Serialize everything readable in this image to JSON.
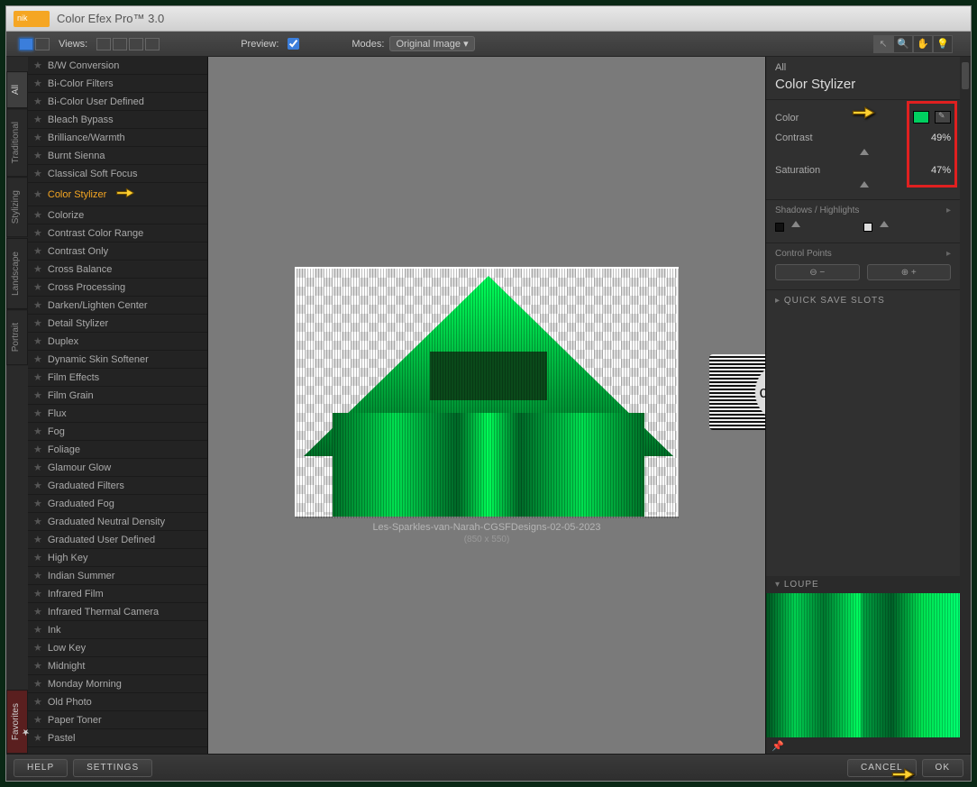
{
  "window": {
    "title": "Color Efex Pro™ 3.0"
  },
  "toolbar": {
    "views_label": "Views:",
    "preview_label": "Preview:",
    "preview_checked": true,
    "modes_label": "Modes:",
    "modes_value": "Original Image"
  },
  "side_tabs": [
    {
      "label": "All",
      "active": true
    },
    {
      "label": "Traditional",
      "active": false
    },
    {
      "label": "Stylizing",
      "active": false
    },
    {
      "label": "Landscape",
      "active": false
    },
    {
      "label": "Portrait",
      "active": false
    }
  ],
  "favorites_tab": "Favorites",
  "filters": [
    "B/W Conversion",
    "Bi-Color Filters",
    "Bi-Color User Defined",
    "Bleach Bypass",
    "Brilliance/Warmth",
    "Burnt Sienna",
    "Classical Soft Focus",
    "Color Stylizer",
    "Colorize",
    "Contrast Color Range",
    "Contrast Only",
    "Cross Balance",
    "Cross Processing",
    "Darken/Lighten Center",
    "Detail Stylizer",
    "Duplex",
    "Dynamic Skin Softener",
    "Film Effects",
    "Film Grain",
    "Flux",
    "Fog",
    "Foliage",
    "Glamour Glow",
    "Graduated Filters",
    "Graduated Fog",
    "Graduated Neutral Density",
    "Graduated User Defined",
    "High Key",
    "Indian Summer",
    "Infrared Film",
    "Infrared Thermal Camera",
    "Ink",
    "Low Key",
    "Midnight",
    "Monday Morning",
    "Old Photo",
    "Paper Toner",
    "Pastel"
  ],
  "selected_filter_index": 7,
  "image": {
    "filename": "Les-Sparkles-van-Narah-CGSFDesigns-02-05-2023",
    "dimensions": "(850 x 550)"
  },
  "right": {
    "all_label": "All",
    "filter_title": "Color Stylizer",
    "color_label": "Color",
    "color_hex": "#00d060",
    "contrast_label": "Contrast",
    "contrast_value": "49%",
    "saturation_label": "Saturation",
    "saturation_value": "47%",
    "shadows_label": "Shadows / Highlights",
    "control_points_label": "Control Points",
    "quick_save_label": "QUICK SAVE SLOTS",
    "loupe_label": "LOUPE"
  },
  "footer": {
    "help": "HELP",
    "settings": "SETTINGS",
    "cancel": "CANCEL",
    "ok": "OK"
  },
  "watermark": "claudia"
}
